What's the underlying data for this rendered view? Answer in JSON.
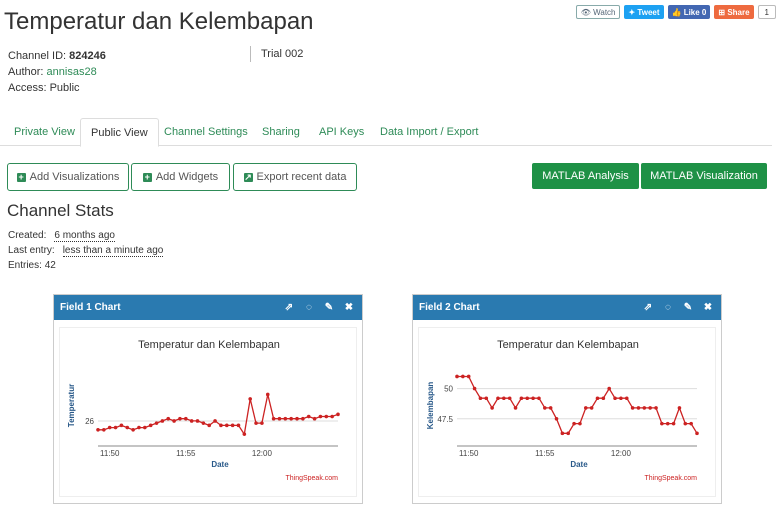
{
  "title": "Temperatur dan Kelembapan",
  "social": {
    "watch": "Watch",
    "tweet": "Tweet",
    "like": "Like 0",
    "share": "Share",
    "count": "1"
  },
  "meta": {
    "channel_id_label": "Channel ID:",
    "channel_id": "824246",
    "author_label": "Author:",
    "author": "annisas28",
    "access_label": "Access:",
    "access": "Public",
    "trial": "Trial 002"
  },
  "tabs": [
    "Private View",
    "Public View",
    "Channel Settings",
    "Sharing",
    "API Keys",
    "Data Import / Export"
  ],
  "active_tab": "Public View",
  "buttons": {
    "add_visualizations": "Add Visualizations",
    "add_widgets": "Add Widgets",
    "export_recent": "Export recent data",
    "matlab_analysis": "MATLAB Analysis",
    "matlab_visualization": "MATLAB Visualization"
  },
  "stats": {
    "title": "Channel Stats",
    "created_label": "Created:",
    "created": "6 months ago",
    "last_entry_label": "Last entry:",
    "last_entry": "less than a minute ago",
    "entries_label": "Entries:",
    "entries": "42"
  },
  "colors": {
    "accent": "#2e8b57",
    "panel_header": "#2a7ab0",
    "line": "#cc2222",
    "button": "#1e9146"
  },
  "chart_data": [
    {
      "panel_title": "Field 1 Chart",
      "type": "line",
      "title": "Temperatur dan Kelembapan",
      "xlabel": "Date",
      "ylabel": "Temperatur",
      "credit": "ThingSpeak.com",
      "x_ticks": [
        "11:50",
        "11:55",
        "12:00"
      ],
      "y_ticks": [
        26
      ],
      "ylim": [
        25.5,
        27.2
      ],
      "values": [
        25.8,
        25.8,
        25.85,
        25.85,
        25.9,
        25.85,
        25.8,
        25.85,
        25.85,
        25.9,
        25.95,
        26.0,
        26.05,
        26.0,
        26.05,
        26.05,
        26.0,
        26.0,
        25.95,
        25.9,
        26.0,
        25.9,
        25.9,
        25.9,
        25.9,
        25.7,
        26.5,
        25.95,
        25.95,
        26.6,
        26.05,
        26.05,
        26.05,
        26.05,
        26.05,
        26.05,
        26.1,
        26.05,
        26.1,
        26.1,
        26.1,
        26.15
      ]
    },
    {
      "panel_title": "Field 2 Chart",
      "type": "line",
      "title": "Temperatur dan Kelembapan",
      "xlabel": "Date",
      "ylabel": "Kelembapan",
      "credit": "ThingSpeak.com",
      "x_ticks": [
        "11:50",
        "11:55",
        "12:00"
      ],
      "y_ticks": [
        47.5,
        50
      ],
      "ylim": [
        45.5,
        51.7
      ],
      "values": [
        51.0,
        51.0,
        51.0,
        50.0,
        49.2,
        49.2,
        48.4,
        49.2,
        49.2,
        49.2,
        48.4,
        49.2,
        49.2,
        49.2,
        49.2,
        48.4,
        48.4,
        47.5,
        46.3,
        46.3,
        47.1,
        47.1,
        48.4,
        48.4,
        49.2,
        49.2,
        50.0,
        49.2,
        49.2,
        49.2,
        48.4,
        48.4,
        48.4,
        48.4,
        48.4,
        47.1,
        47.1,
        47.1,
        48.4,
        47.1,
        47.1,
        46.3
      ]
    }
  ]
}
